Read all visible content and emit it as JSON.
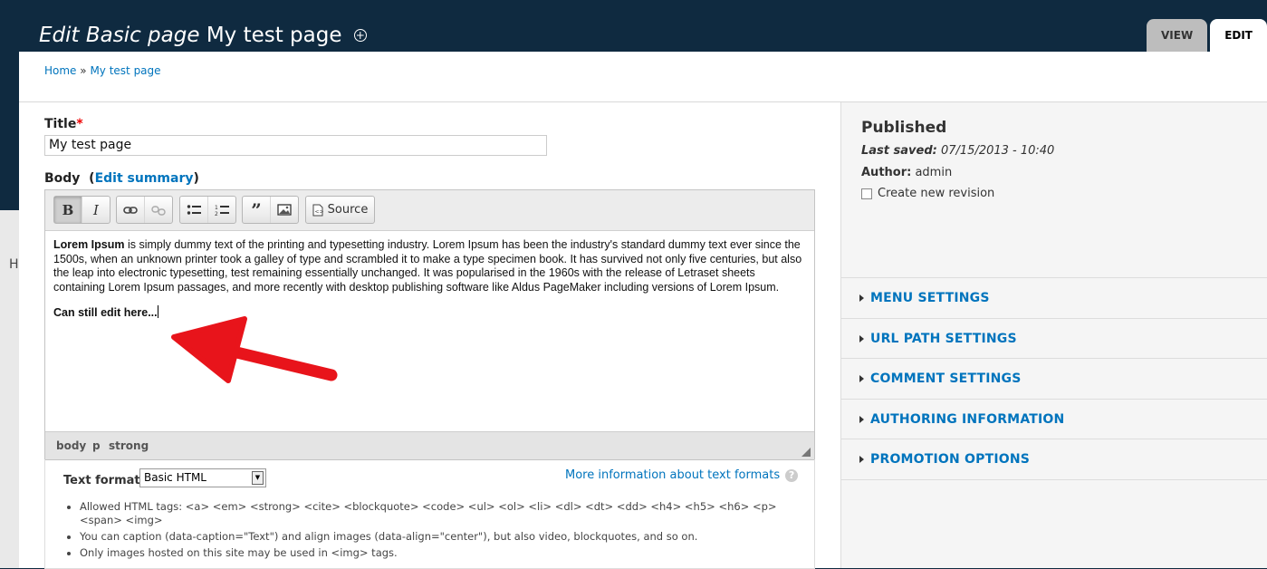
{
  "header": {
    "title_prefix": "Edit Basic page",
    "title_name": "My test page",
    "shortcut_icon": "plus-circle-icon",
    "tabs": [
      {
        "label": "VIEW",
        "active": false
      },
      {
        "label": "EDIT",
        "active": true
      }
    ]
  },
  "breadcrumb": {
    "home": "Home",
    "separator": "»",
    "current": "My test page"
  },
  "side_fragment": "H",
  "form": {
    "title_label": "Title",
    "required_marker": "*",
    "title_value": "My test page",
    "body_label": "Body",
    "edit_summary": "Edit summary",
    "toolbar": {
      "buttons": [
        "bold",
        "italic",
        "link",
        "unlink",
        "bulleted-list",
        "numbered-list",
        "blockquote",
        "image",
        "source"
      ],
      "bold_glyph": "B",
      "italic_glyph": "I",
      "source_label": "Source"
    },
    "content": {
      "para1_strong": "Lorem Ipsum",
      "para1_rest": " is simply dummy text of the printing and typesetting industry. Lorem Ipsum has been the industry's standard dummy text ever since the 1500s, when an unknown printer took a galley of type and scrambled it to make a type specimen book. It has survived not only five centuries, but also the leap into electronic typesetting, test remaining essentially unchanged. It was popularised in the 1960s with the release of Letraset sheets containing Lorem Ipsum passages, and more recently with desktop publishing software like Aldus PageMaker including versions of Lorem Ipsum.",
      "para2": "Can still edit here..."
    },
    "path": [
      "body",
      "p",
      "strong"
    ],
    "text_format": {
      "label": "Text format",
      "selected": "Basic HTML",
      "more_info": "More information about text formats",
      "help_icon": "?",
      "tips": [
        "Allowed HTML tags: <a> <em> <strong> <cite> <blockquote> <code> <ul> <ol> <li> <dl> <dt> <dd> <h4> <h5> <h6> <p> <span> <img>",
        "You can caption (data-caption=\"Text\") and align images (data-align=\"center\"), but also video, blockquotes, and so on.",
        "Only images hosted on this site may be used in <img> tags."
      ]
    }
  },
  "sidebar": {
    "status": "Published",
    "last_saved_label": "Last saved:",
    "last_saved_value": "07/15/2013 - 10:40",
    "author_label": "Author:",
    "author_value": "admin",
    "revision_label": "Create new revision",
    "revision_checked": false,
    "sections": [
      "MENU SETTINGS",
      "URL PATH SETTINGS",
      "COMMENT SETTINGS",
      "AUTHORING INFORMATION",
      "PROMOTION OPTIONS"
    ]
  },
  "annotation": {
    "arrow_color": "#e8141b"
  },
  "colors": {
    "header_bg": "#0f2a40",
    "link": "#0074bd",
    "required": "#e00000"
  }
}
